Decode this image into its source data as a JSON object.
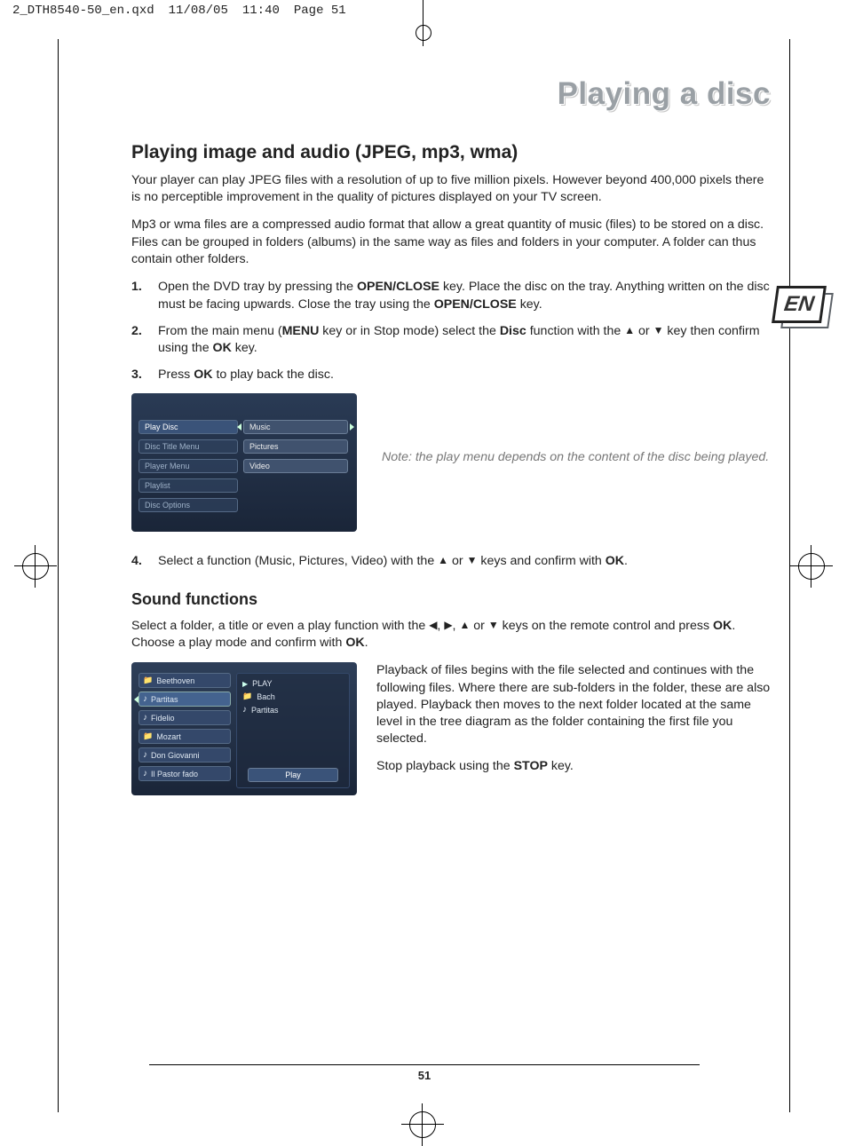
{
  "docinfo": {
    "filename": "2_DTH8540-50_en.qxd",
    "date": "11/08/05",
    "time": "11:40",
    "pagetoken": "Page 51"
  },
  "lang_badge": "EN",
  "page_title": "Playing a disc",
  "h2": "Playing image and audio (JPEG, mp3, wma)",
  "p1": "Your player can play JPEG files with a resolution of up to five million pixels. However beyond 400,000 pixels there is no perceptible improvement in the quality of pictures displayed on your TV screen.",
  "p2": "Mp3 or wma files are a compressed audio format that allow a great quantity of music (files) to be stored on a disc.  Files can be grouped in folders (albums) in the same way as files and folders in your computer. A folder can thus contain other folders.",
  "steps": {
    "s1a": "Open the DVD tray by pressing the ",
    "s1b": "OPEN/CLOSE",
    "s1c": " key. Place the disc on the tray. Anything written on the disc must be facing upwards. Close the tray using the ",
    "s1d": "OPEN/CLOSE",
    "s1e": " key.",
    "s2a": "From the main menu (",
    "s2b": "MENU",
    "s2c": " key or in Stop mode) select the ",
    "s2d": "Disc",
    "s2e": " function with the ",
    "s2f": " or ",
    "s2g": " key then confirm using the ",
    "s2h": "OK",
    "s2i": " key.",
    "s3a": "Press ",
    "s3b": "OK",
    "s3c": " to play back the disc.",
    "s4a": "Select a function (Music, Pictures, Video) with the ",
    "s4b": " or ",
    "s4c": " keys and confirm with ",
    "s4d": "OK",
    "s4e": "."
  },
  "note1": "Note: the play menu depends on the content of the disc being played.",
  "h3": "Sound functions",
  "sound_p1a": "Select a folder, a title or even a play function with the ",
  "sound_p1b": " keys on the remote control and press ",
  "sound_p1c": "OK",
  "sound_p1d": ". Choose a play mode and confirm with ",
  "sound_p1e": "OK",
  "sound_p1f": ".",
  "sep_comma": ", ",
  "sep_or": " or ",
  "rt_p1a": "Playback of files begins with the file selected and continues with the following files. Where there are sub-folders in the folder, these are also played. Playback then moves to the next folder located at the same level in the tree diagram as the folder containing the first file you selected.",
  "rt_p2a": "Stop playback using the ",
  "rt_p2b": "STOP",
  "rt_p2c": " key.",
  "ui1": {
    "left": [
      "Play Disc",
      "Disc Title Menu",
      "Player Menu",
      "Playlist",
      "Disc Options"
    ],
    "right": [
      "Music",
      "Pictures",
      "Video"
    ]
  },
  "ui2": {
    "files": [
      "Beethoven",
      "Partitas",
      "Fidelio",
      "Mozart",
      "Don Giovanni",
      "Il Pastor fado"
    ],
    "panel_head": "PLAY",
    "panel_lines": [
      "Bach",
      "Partitas"
    ],
    "play_button": "Play"
  },
  "page_number": "51"
}
